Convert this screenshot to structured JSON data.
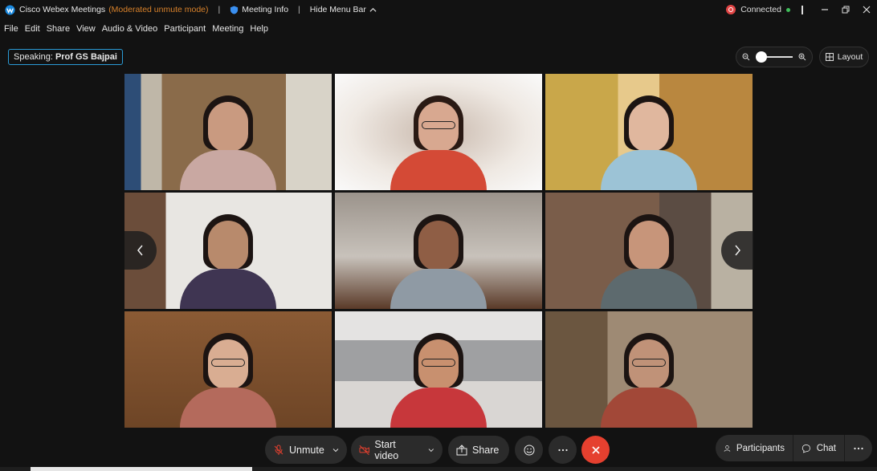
{
  "titlebar": {
    "app_title": "Cisco Webex Meetings",
    "mode": "(Moderated unmute mode)",
    "separator": "|",
    "meeting_info": "Meeting Info",
    "hide_menu_bar": "Hide Menu Bar",
    "status": "Connected"
  },
  "menu": [
    "File",
    "Edit",
    "Share",
    "View",
    "Audio & Video",
    "Participant",
    "Meeting",
    "Help"
  ],
  "speaking": {
    "label": "Speaking:",
    "name": "Prof GS Bajpai"
  },
  "zoom": {
    "level": 0.0
  },
  "layout_label": "Layout",
  "controls": {
    "unmute": "Unmute",
    "start_video": "Start video",
    "share": "Share",
    "participants": "Participants",
    "chat": "Chat"
  },
  "colors": {
    "end_call": "#e5402f",
    "speaking_border": "#2a9bd6",
    "mode_text": "#d9822b",
    "connected_dot": "#3fbf5a"
  }
}
